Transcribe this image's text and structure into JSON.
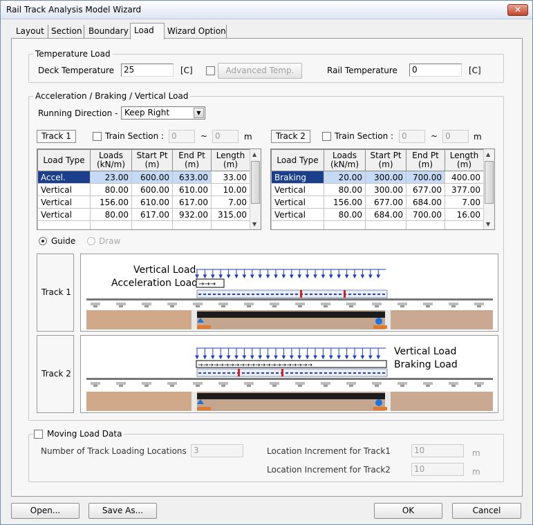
{
  "window": {
    "title": "Rail Track Analysis Model Wizard",
    "close": "✕"
  },
  "tabs": [
    "Layout",
    "Section",
    "Boundary",
    "Load",
    "Wizard Option"
  ],
  "temperature": {
    "group_label": "Temperature Load",
    "deck_label": "Deck Temperature",
    "deck_value": "25",
    "deck_unit": "[C]",
    "advanced_button": "Advanced Temp.",
    "rail_label": "Rail Temperature",
    "rail_value": "0",
    "rail_unit": "[C]"
  },
  "accel": {
    "group_label": "Acceleration / Braking / Vertical Load",
    "direction_label": "Running Direction -",
    "direction_value": "Keep Right",
    "track1": {
      "label": "Track 1",
      "train_section_label": "Train Section :",
      "from": "0",
      "to": "0",
      "unit": "m"
    },
    "track2": {
      "label": "Track 2",
      "train_section_label": "Train Section :",
      "from": "0",
      "to": "0",
      "unit": "m"
    },
    "columns": [
      "Load Type",
      "Loads (kN/m)",
      "Start Pt (m)",
      "End Pt (m)",
      "Length (m)"
    ],
    "column_lines": [
      [
        "Load Type",
        ""
      ],
      [
        "Loads",
        "(kN/m)"
      ],
      [
        "Start Pt",
        "(m)"
      ],
      [
        "End Pt",
        "(m)"
      ],
      [
        "Length",
        "(m)"
      ]
    ],
    "track1_rows": [
      [
        "Accel.",
        "23.00",
        "600.00",
        "633.00",
        "33.00"
      ],
      [
        "Vertical",
        "80.00",
        "600.00",
        "610.00",
        "10.00"
      ],
      [
        "Vertical",
        "156.00",
        "610.00",
        "617.00",
        "7.00"
      ],
      [
        "Vertical",
        "80.00",
        "617.00",
        "932.00",
        "315.00"
      ]
    ],
    "track2_rows": [
      [
        "Braking",
        "20.00",
        "300.00",
        "700.00",
        "400.00"
      ],
      [
        "Vertical",
        "80.00",
        "300.00",
        "677.00",
        "377.00"
      ],
      [
        "Vertical",
        "156.00",
        "677.00",
        "684.00",
        "7.00"
      ],
      [
        "Vertical",
        "80.00",
        "684.00",
        "700.00",
        "16.00"
      ]
    ]
  },
  "view": {
    "guide": "Guide",
    "draw": "Draw"
  },
  "diagram": {
    "track1_label": "Track 1",
    "track2_label": "Track 2",
    "t1_vertical": "Vertical Load",
    "t1_accel": "Acceleration Load",
    "t2_vertical": "Vertical Load",
    "t2_braking": "Braking Load"
  },
  "moving": {
    "group_label": "Moving Load Data",
    "num_label": "Number of Track Loading Locations",
    "num_value": "3",
    "inc1_label": "Location Increment for Track1",
    "inc1_value": "10",
    "inc1_unit": "m",
    "inc2_label": "Location Increment for Track2",
    "inc2_value": "10",
    "inc2_unit": "m"
  },
  "buttons": {
    "open": "Open...",
    "saveas": "Save As...",
    "ok": "OK",
    "cancel": "Cancel"
  }
}
